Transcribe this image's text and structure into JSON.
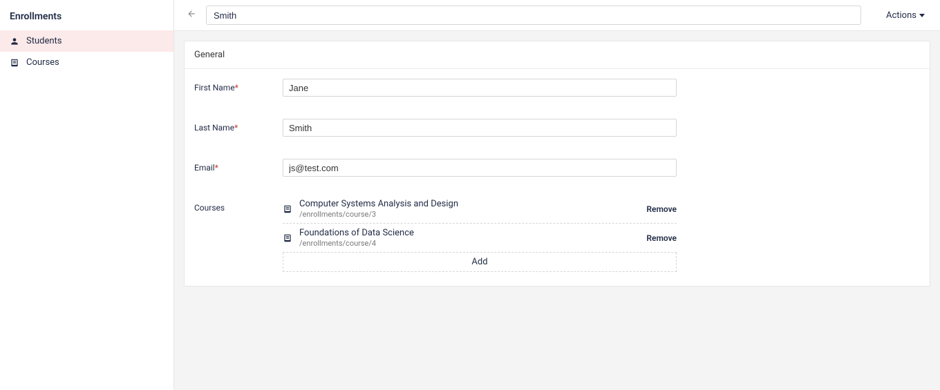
{
  "sidebar": {
    "title": "Enrollments",
    "items": [
      {
        "label": "Students",
        "icon": "person-icon",
        "active": true
      },
      {
        "label": "Courses",
        "icon": "book-icon",
        "active": false
      }
    ]
  },
  "header": {
    "title_value": "Smith",
    "actions_label": "Actions"
  },
  "panel": {
    "section_title": "General",
    "fields": {
      "first_name": {
        "label": "First Name",
        "required": true,
        "value": "Jane"
      },
      "last_name": {
        "label": "Last Name",
        "required": true,
        "value": "Smith"
      },
      "email": {
        "label": "Email",
        "required": true,
        "value": "js@test.com"
      },
      "courses": {
        "label": "Courses"
      }
    },
    "courses": [
      {
        "title": "Computer Systems Analysis and Design",
        "path": "/enrollments/course/3",
        "remove_label": "Remove"
      },
      {
        "title": "Foundations of Data Science",
        "path": "/enrollments/course/4",
        "remove_label": "Remove"
      }
    ],
    "add_label": "Add"
  }
}
